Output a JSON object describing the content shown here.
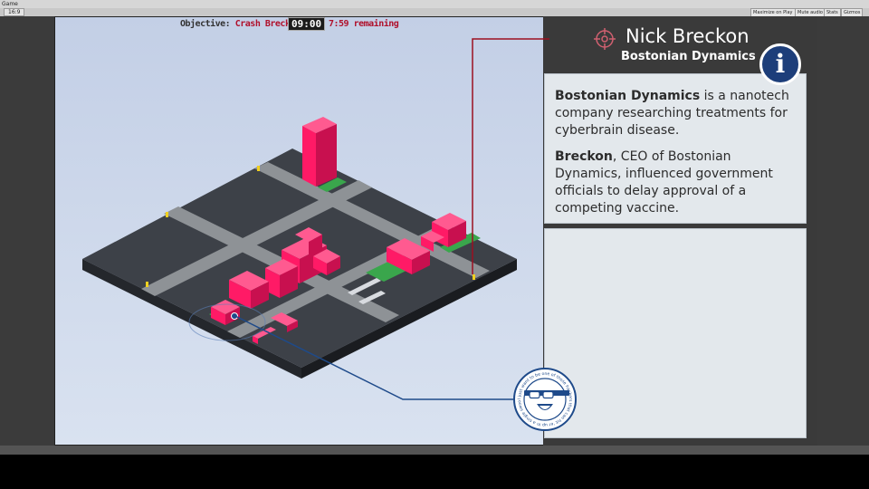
{
  "editor": {
    "tab_label": "Game",
    "aspect_label": "16:9",
    "buttons": [
      "Maximize on Play",
      "Mute audio",
      "Stats",
      "Gizmos"
    ]
  },
  "hud": {
    "objective_label": "Objective:",
    "objective_value": "Crash Breckon",
    "timer": "09:00",
    "remaining": "7:59 remaining"
  },
  "target": {
    "name": "Nick Breckon",
    "company": "Bostonian Dynamics",
    "info_icon": "i",
    "para1_bold": "Bostonian Dynamics",
    "para1_rest": " is a nanotech company researching treatments for cyberbrain disease.",
    "para2_bold": "Breckon",
    "para2_rest": ", CEO of Bostonian Dynamics, influenced government officials to delay approval of a competing vaccine."
  },
  "badge": {
    "text": "I just want to be one of those hackers that can hit 'er up in a single swoop"
  },
  "icons": {
    "target_icon": "crosshair-icon",
    "info_icon": "info-icon",
    "badge_icon": "laughing-man-icon"
  },
  "colors": {
    "building": "#ff1a66",
    "road": "#8e9296",
    "block": "#3d4148",
    "park": "#3aa64c",
    "objective_red": "#b0102b",
    "info_blue": "#1d3e7a",
    "connector_red": "#9b1020",
    "connector_blue": "#1e4a8a"
  }
}
